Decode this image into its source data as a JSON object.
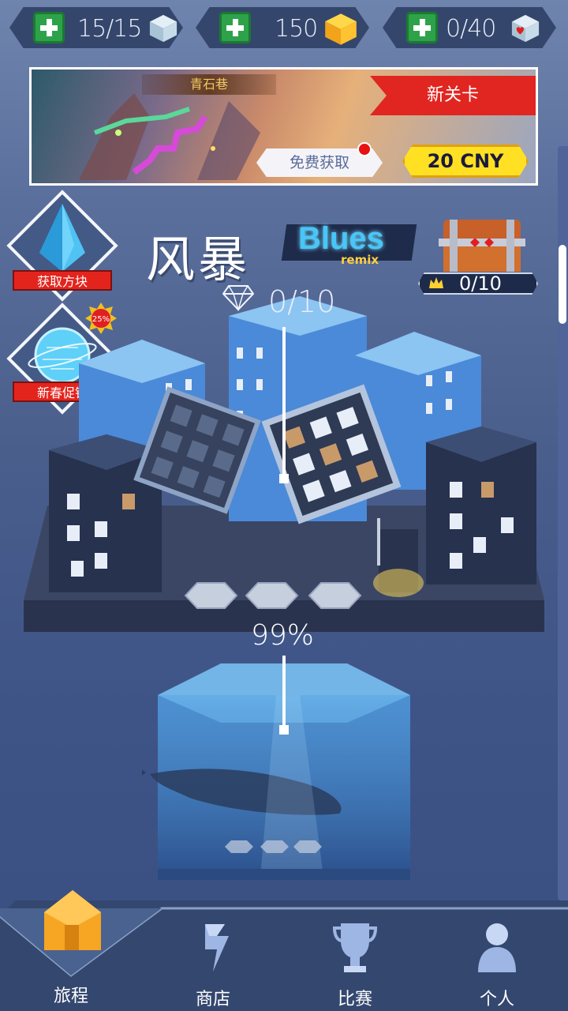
{
  "resources": [
    {
      "value": "15/15",
      "icon": "ice-cube-icon"
    },
    {
      "value": "150",
      "icon": "gold-cube-icon"
    },
    {
      "value": "0/40",
      "icon": "heart-cube-icon"
    }
  ],
  "banner": {
    "level_name": "青石巷",
    "ribbon": "新关卡",
    "free_button": "免费获取",
    "price_button": "20 CNY"
  },
  "side_buttons": [
    {
      "label": "获取方块",
      "icon": "water-drop-icon"
    },
    {
      "label": "新春促销",
      "icon": "globe-icon",
      "badge": "25%"
    }
  ],
  "song": {
    "title": "风暴",
    "genre": "Blues",
    "genre_sub": "remix"
  },
  "chest": {
    "count": "0/10"
  },
  "level_progress": {
    "gems": "0/10",
    "percent": "99%"
  },
  "nav": [
    {
      "label": "旅程",
      "icon": "home-icon",
      "active": true
    },
    {
      "label": "商店",
      "icon": "shop-icon",
      "active": false
    },
    {
      "label": "比赛",
      "icon": "trophy-icon",
      "active": false
    },
    {
      "label": "个人",
      "icon": "person-icon",
      "active": false
    }
  ],
  "colors": {
    "accent_green": "#2ea24a",
    "ribbon_red": "#e12520",
    "price_yellow": "#ffe023",
    "bg_blue": "#4a5e8c",
    "nav_orange": "#f5a623"
  }
}
